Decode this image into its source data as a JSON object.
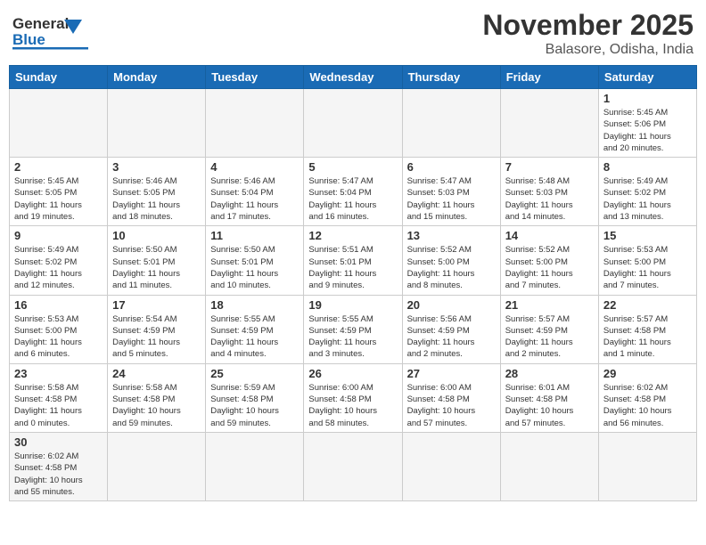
{
  "header": {
    "logo_general": "General",
    "logo_blue": "Blue",
    "month_title": "November 2025",
    "location": "Balasore, Odisha, India"
  },
  "weekdays": [
    "Sunday",
    "Monday",
    "Tuesday",
    "Wednesday",
    "Thursday",
    "Friday",
    "Saturday"
  ],
  "days": [
    {
      "date": "",
      "info": ""
    },
    {
      "date": "",
      "info": ""
    },
    {
      "date": "",
      "info": ""
    },
    {
      "date": "",
      "info": ""
    },
    {
      "date": "",
      "info": ""
    },
    {
      "date": "",
      "info": ""
    },
    {
      "date": "1",
      "info": "Sunrise: 5:45 AM\nSunset: 5:06 PM\nDaylight: 11 hours\nand 20 minutes."
    },
    {
      "date": "2",
      "info": "Sunrise: 5:45 AM\nSunset: 5:05 PM\nDaylight: 11 hours\nand 19 minutes."
    },
    {
      "date": "3",
      "info": "Sunrise: 5:46 AM\nSunset: 5:05 PM\nDaylight: 11 hours\nand 18 minutes."
    },
    {
      "date": "4",
      "info": "Sunrise: 5:46 AM\nSunset: 5:04 PM\nDaylight: 11 hours\nand 17 minutes."
    },
    {
      "date": "5",
      "info": "Sunrise: 5:47 AM\nSunset: 5:04 PM\nDaylight: 11 hours\nand 16 minutes."
    },
    {
      "date": "6",
      "info": "Sunrise: 5:47 AM\nSunset: 5:03 PM\nDaylight: 11 hours\nand 15 minutes."
    },
    {
      "date": "7",
      "info": "Sunrise: 5:48 AM\nSunset: 5:03 PM\nDaylight: 11 hours\nand 14 minutes."
    },
    {
      "date": "8",
      "info": "Sunrise: 5:49 AM\nSunset: 5:02 PM\nDaylight: 11 hours\nand 13 minutes."
    },
    {
      "date": "9",
      "info": "Sunrise: 5:49 AM\nSunset: 5:02 PM\nDaylight: 11 hours\nand 12 minutes."
    },
    {
      "date": "10",
      "info": "Sunrise: 5:50 AM\nSunset: 5:01 PM\nDaylight: 11 hours\nand 11 minutes."
    },
    {
      "date": "11",
      "info": "Sunrise: 5:50 AM\nSunset: 5:01 PM\nDaylight: 11 hours\nand 10 minutes."
    },
    {
      "date": "12",
      "info": "Sunrise: 5:51 AM\nSunset: 5:01 PM\nDaylight: 11 hours\nand 9 minutes."
    },
    {
      "date": "13",
      "info": "Sunrise: 5:52 AM\nSunset: 5:00 PM\nDaylight: 11 hours\nand 8 minutes."
    },
    {
      "date": "14",
      "info": "Sunrise: 5:52 AM\nSunset: 5:00 PM\nDaylight: 11 hours\nand 7 minutes."
    },
    {
      "date": "15",
      "info": "Sunrise: 5:53 AM\nSunset: 5:00 PM\nDaylight: 11 hours\nand 7 minutes."
    },
    {
      "date": "16",
      "info": "Sunrise: 5:53 AM\nSunset: 5:00 PM\nDaylight: 11 hours\nand 6 minutes."
    },
    {
      "date": "17",
      "info": "Sunrise: 5:54 AM\nSunset: 4:59 PM\nDaylight: 11 hours\nand 5 minutes."
    },
    {
      "date": "18",
      "info": "Sunrise: 5:55 AM\nSunset: 4:59 PM\nDaylight: 11 hours\nand 4 minutes."
    },
    {
      "date": "19",
      "info": "Sunrise: 5:55 AM\nSunset: 4:59 PM\nDaylight: 11 hours\nand 3 minutes."
    },
    {
      "date": "20",
      "info": "Sunrise: 5:56 AM\nSunset: 4:59 PM\nDaylight: 11 hours\nand 2 minutes."
    },
    {
      "date": "21",
      "info": "Sunrise: 5:57 AM\nSunset: 4:59 PM\nDaylight: 11 hours\nand 2 minutes."
    },
    {
      "date": "22",
      "info": "Sunrise: 5:57 AM\nSunset: 4:58 PM\nDaylight: 11 hours\nand 1 minute."
    },
    {
      "date": "23",
      "info": "Sunrise: 5:58 AM\nSunset: 4:58 PM\nDaylight: 11 hours\nand 0 minutes."
    },
    {
      "date": "24",
      "info": "Sunrise: 5:58 AM\nSunset: 4:58 PM\nDaylight: 10 hours\nand 59 minutes."
    },
    {
      "date": "25",
      "info": "Sunrise: 5:59 AM\nSunset: 4:58 PM\nDaylight: 10 hours\nand 59 minutes."
    },
    {
      "date": "26",
      "info": "Sunrise: 6:00 AM\nSunset: 4:58 PM\nDaylight: 10 hours\nand 58 minutes."
    },
    {
      "date": "27",
      "info": "Sunrise: 6:00 AM\nSunset: 4:58 PM\nDaylight: 10 hours\nand 57 minutes."
    },
    {
      "date": "28",
      "info": "Sunrise: 6:01 AM\nSunset: 4:58 PM\nDaylight: 10 hours\nand 57 minutes."
    },
    {
      "date": "29",
      "info": "Sunrise: 6:02 AM\nSunset: 4:58 PM\nDaylight: 10 hours\nand 56 minutes."
    },
    {
      "date": "30",
      "info": "Sunrise: 6:02 AM\nSunset: 4:58 PM\nDaylight: 10 hours\nand 55 minutes."
    }
  ]
}
